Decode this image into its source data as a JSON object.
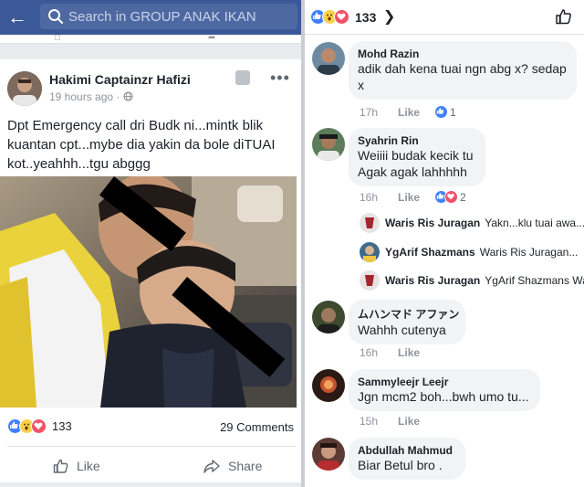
{
  "left": {
    "header": {
      "search_placeholder": "Search in GROUP ANAK IKAN"
    },
    "post": {
      "author": "Hakimi Captainzr Hafizi",
      "time": "19 hours ago",
      "privacy_icon": "globe-icon",
      "text": "Dpt Emergency call dri Budk ni...mintk blik kuantan cpt...mybe dia yakin da bole diTUAI kot..yeahhh...tgu abggg",
      "reaction_icons": [
        "like-icon",
        "wow-icon",
        "love-icon"
      ],
      "reaction_count": "133",
      "comments_count": "29 Comments",
      "actions": {
        "like": "Like",
        "share": "Share"
      }
    }
  },
  "right": {
    "reaction_icons": [
      "like-icon",
      "wow-icon",
      "love-icon"
    ],
    "reaction_count": "133",
    "comments": [
      {
        "name": "Mohd Razin",
        "text_lines": [
          "adik dah kena tuai ngn abg x? sedap",
          "x"
        ],
        "time": "17h",
        "like_label": "Like",
        "reactions": [
          "like-icon"
        ],
        "reaction_count": "1"
      },
      {
        "name": "Syahrin Rin",
        "text_lines": [
          "Weiiii budak kecik tu",
          "Agak agak lahhhhh"
        ],
        "time": "16h",
        "like_label": "Like",
        "reactions": [
          "like-icon",
          "love-icon"
        ],
        "reaction_count": "2"
      },
      {
        "name": "ムハンマド アファン",
        "text_lines": [
          "Wahhh cutenya"
        ],
        "time": "16h",
        "like_label": "Like"
      },
      {
        "name": "Sammyleejr Leejr",
        "text_lines": [
          "Jgn mcm2 boh...bwh umo tu..."
        ],
        "time": "15h",
        "like_label": "Like"
      },
      {
        "name": "Abdullah Mahmud",
        "text_lines": [
          "Biar Betul bro ."
        ]
      }
    ],
    "replies": [
      {
        "name": "Waris Ris Juragan",
        "text": "Yakn...klu tuai awa..."
      },
      {
        "name": "YgArif Shazmans",
        "text": "Waris Ris Juragan..."
      },
      {
        "name": "Waris Ris Juragan",
        "text": "YgArif Shazmans Waris..."
      }
    ]
  },
  "colors": {
    "brand": "#3b5998",
    "like_blue": "#4080ff",
    "love_red": "#f25268",
    "wow_yellow": "#fcd04d",
    "bubble_bg": "#f2f3f5",
    "meta_gray": "#90949c"
  }
}
